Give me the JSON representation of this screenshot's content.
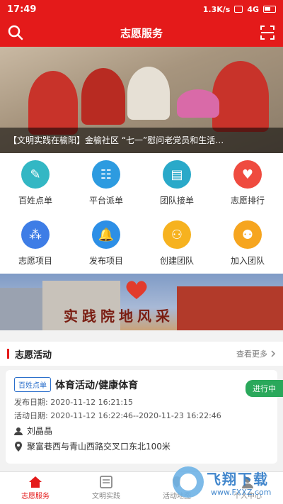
{
  "statusbar": {
    "time": "17:49",
    "speed": "1.3K/s",
    "battery": "4G"
  },
  "header": {
    "title": "志愿服务"
  },
  "banner": {
    "caption": "【文明实践在榆阳】金榆社区 “七一”慰问老党员和生活…"
  },
  "grid": {
    "items": [
      {
        "label": "百姓点单",
        "icon": "order-icon",
        "color": "#33b7c4"
      },
      {
        "label": "平台派单",
        "icon": "dispatch-icon",
        "color": "#2d9be0"
      },
      {
        "label": "团队接单",
        "icon": "team-accept-icon",
        "color": "#2aa9c9"
      },
      {
        "label": "志愿排行",
        "icon": "heart-rank-icon",
        "color": "#ef4b3f"
      },
      {
        "label": "志愿项目",
        "icon": "project-icon",
        "color": "#3e7de6"
      },
      {
        "label": "发布项目",
        "icon": "publish-icon",
        "color": "#2d8fe6"
      },
      {
        "label": "创建团队",
        "icon": "create-team-icon",
        "color": "#f6b21f"
      },
      {
        "label": "加入团队",
        "icon": "join-team-icon",
        "color": "#f6a51f"
      }
    ]
  },
  "promo": {
    "slogan": "实践院地风采"
  },
  "section": {
    "title": "志愿活动",
    "more": "查看更多"
  },
  "card": {
    "tag": "百姓点单",
    "title": "体育活动/健康体育",
    "status": "进行中",
    "publish_date": "发布日期: 2020-11-12 16:21:15",
    "activity_date": "活动日期: 2020-11-12 16:22:46--2020-11-23 16:22:46",
    "person": "刘晶晶",
    "address": "聚富巷西与青山西路交叉口东北100米"
  },
  "bottomnav": {
    "items": [
      {
        "label": "志愿服务",
        "icon": "home-icon",
        "active": true
      },
      {
        "label": "文明实践",
        "icon": "news-icon",
        "active": false
      },
      {
        "label": "活动地图",
        "icon": "map-icon",
        "active": false
      },
      {
        "label": "个人中心",
        "icon": "user-icon",
        "active": false
      }
    ]
  },
  "watermark": {
    "text": "飞翔下载",
    "sub": "www.FXXZ.com"
  }
}
